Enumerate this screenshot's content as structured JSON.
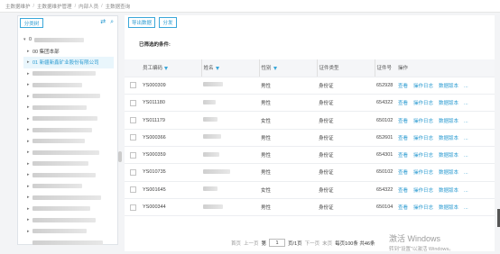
{
  "breadcrumb": [
    "主数据维护",
    "主数据维护管理",
    "内部人员",
    "主数据查询"
  ],
  "left_panel": {
    "tab_label": "分类树",
    "tree": [
      {
        "label": "0",
        "arrow": "▾",
        "indent": 0,
        "blur": 55
      },
      {
        "label": "00 集团本部",
        "arrow": "▸",
        "indent": 4
      },
      {
        "label": "01 新疆新鑫矿业股份有限公司",
        "arrow": "▸",
        "indent": 4,
        "selected": true
      },
      {
        "label": "",
        "arrow": "▸",
        "indent": 4,
        "blur": 70
      },
      {
        "label": "",
        "arrow": "▸",
        "indent": 4,
        "blur": 55
      },
      {
        "label": "",
        "arrow": "▸",
        "indent": 4,
        "blur": 75
      },
      {
        "label": "",
        "arrow": "▸",
        "indent": 4,
        "blur": 60
      },
      {
        "label": "",
        "arrow": "▸",
        "indent": 4,
        "blur": 72
      },
      {
        "label": "",
        "arrow": "▸",
        "indent": 4,
        "blur": 66
      },
      {
        "label": "",
        "arrow": "▸",
        "indent": 4,
        "blur": 58
      },
      {
        "label": "",
        "arrow": "▸",
        "indent": 4,
        "blur": 74
      },
      {
        "label": "",
        "arrow": "▸",
        "indent": 4,
        "blur": 62
      },
      {
        "label": "",
        "arrow": "▸",
        "indent": 4,
        "blur": 70
      },
      {
        "label": "",
        "arrow": "▸",
        "indent": 4,
        "blur": 55
      },
      {
        "label": "",
        "arrow": "▸",
        "indent": 4,
        "blur": 76
      },
      {
        "label": "",
        "arrow": "▸",
        "indent": 4,
        "blur": 64
      },
      {
        "label": "",
        "arrow": "▸",
        "indent": 4,
        "blur": 70
      },
      {
        "label": "",
        "arrow": "▸",
        "indent": 4,
        "blur": 60
      },
      {
        "label": "",
        "arrow": "",
        "indent": 4,
        "blur": 78
      }
    ]
  },
  "toolbar": {
    "export_label": "导出数据",
    "dispatch_label": "分发"
  },
  "selected_conditions_label": "已筛选的条件:",
  "table": {
    "headers": [
      "员工编码",
      "姓名",
      "性别",
      "证件类型",
      "证件号",
      "操作"
    ],
    "rows": [
      {
        "code": "YS000309",
        "gender": "男性",
        "idtype": "身份证",
        "idno": "652928"
      },
      {
        "code": "YS011180",
        "gender": "男性",
        "idtype": "身份证",
        "idno": "654322"
      },
      {
        "code": "YS011179",
        "gender": "女性",
        "idtype": "身份证",
        "idno": "650102"
      },
      {
        "code": "YS000366",
        "gender": "男性",
        "idtype": "身份证",
        "idno": "652601"
      },
      {
        "code": "YS000359",
        "gender": "男性",
        "idtype": "身份证",
        "idno": "654301"
      },
      {
        "code": "YS010735",
        "gender": "男性",
        "idtype": "身份证",
        "idno": "650102"
      },
      {
        "code": "YS001645",
        "gender": "女性",
        "idtype": "身份证",
        "idno": "654322"
      },
      {
        "code": "YS000344",
        "gender": "男性",
        "idtype": "身份证",
        "idno": "650104"
      }
    ],
    "actions": [
      "查看",
      "操作日志",
      "数据版本",
      "..."
    ]
  },
  "pager": {
    "first": "首页",
    "prev": "上一页",
    "page_prefix": "第",
    "page_value": "1",
    "page_suffix": "页/1页",
    "next": "下一页",
    "last": "末页",
    "summary": "每页100条 共46条"
  },
  "watermark": {
    "line1": "激活 Windows",
    "line2": "转到\"设置\"以激活 Windows。"
  }
}
